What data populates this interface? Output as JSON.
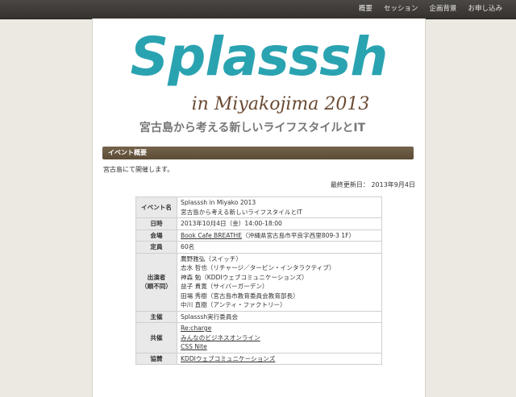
{
  "nav": {
    "items": [
      "概要",
      "セッション",
      "企画背景",
      "お申し込み"
    ]
  },
  "logo": {
    "title": "Splasssh",
    "subtitle": "in Miyakojima 2013",
    "tagline": "宮古島から考える新しいライフスタイルとIT"
  },
  "section": {
    "heading": "イベント概要",
    "intro": "宮古島にて開催します。",
    "updated": "最終更新日： 2013年9月4日"
  },
  "table": {
    "event_label": "イベント名",
    "event_lines": [
      "Splasssh in Miyako 2013",
      "宮古島から考える新しいライフスタイルとIT"
    ],
    "date_label": "日時",
    "date_value": "2013年10月4日（金）14:00-18:00",
    "venue_label": "会場",
    "venue_link": "Book Cafe BREATHE",
    "venue_address": "（沖縄県宮古島市平良字西里809-3 1F）",
    "capacity_label": "定員",
    "capacity_value": "60名",
    "speakers_label_1": "出演者",
    "speakers_label_2": "（順不同）",
    "speakers": [
      "鷹野雅弘（スイッチ）",
      "志水 哲也（リチャージ／タービン・インタラクティブ）",
      "神森 勉（KDDIウェブコミュニケーションズ）",
      "益子 貴寛（サイバーガーデン）",
      "田場 秀樹（宮古島市教育委員会教育部長）",
      "中川 直樹（アンティ・ファクトリー）"
    ],
    "organizer_label": "主催",
    "organizer_value": "Splasssh実行委員会",
    "cohost_label": "共催",
    "cohosts": [
      "Re:charge",
      "みんなのビジネスオンライン",
      "CSS Nite"
    ],
    "sponsor_label": "協賛",
    "sponsor_value": "KDDIウェブコミュニケーションズ"
  },
  "colors": {
    "logo_teal": "#2aa3b1",
    "logo_brown": "#6b4a33",
    "section_bar": "#5c4c37"
  }
}
